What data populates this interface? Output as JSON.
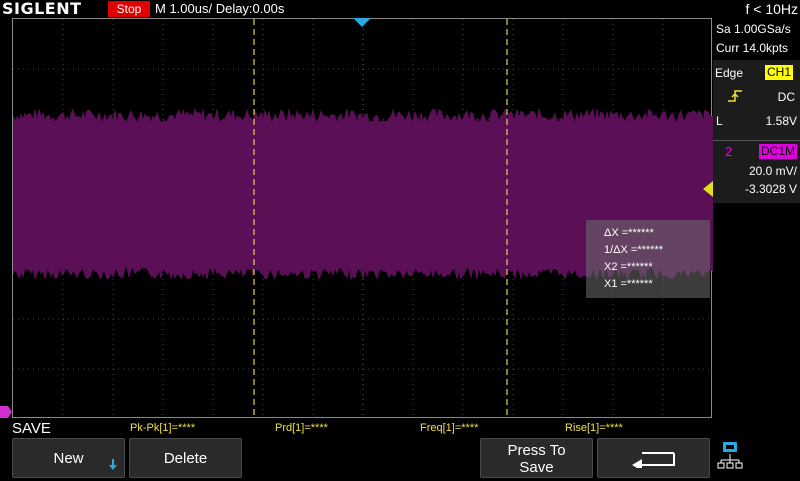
{
  "brand": "SIGLENT",
  "run_state": "Stop",
  "timebase": "M 1.00us/  Delay:0.00s",
  "frequency": "f < 10Hz",
  "acquisition": {
    "sample_rate": "Sa 1.00GSa/s",
    "memory_depth": "Curr 14.0kpts"
  },
  "trigger": {
    "type": "Edge",
    "source": "CH1",
    "coupling": "DC",
    "level_label": "L",
    "level": "1.58V"
  },
  "channel": {
    "number": "2",
    "coupling": "DC1M",
    "scale": "20.0 mV/",
    "offset": "-3.3028 V"
  },
  "cursors": {
    "delta_x": "ΔX =******",
    "inv_delta_x": "1/ΔX =******",
    "x2": "X2 =******",
    "x1": "X1 =******"
  },
  "measurements": [
    "Pk-Pk[1]=****",
    "Prd[1]=****",
    "Freq[1]=****",
    "Rise[1]=****"
  ],
  "menu": {
    "title": "SAVE",
    "softkeys": [
      {
        "label": "New"
      },
      {
        "label": "Delete"
      },
      {
        "label": ""
      },
      {
        "label": "Press To Save"
      },
      {
        "label": ""
      }
    ]
  },
  "colors": {
    "trace": "#5a0f56",
    "cursor_line": "#e8d050",
    "trigger_marker": "#27a9e1",
    "channel_marker": "#e4e01a",
    "ch1_highlight": "#ffff00",
    "ch2_highlight": "#e000e0",
    "stop_red": "#e00000"
  },
  "icons": {
    "new_arrow": "arrow-down-icon",
    "back": "return-arrow-icon",
    "network": "network-icon"
  }
}
